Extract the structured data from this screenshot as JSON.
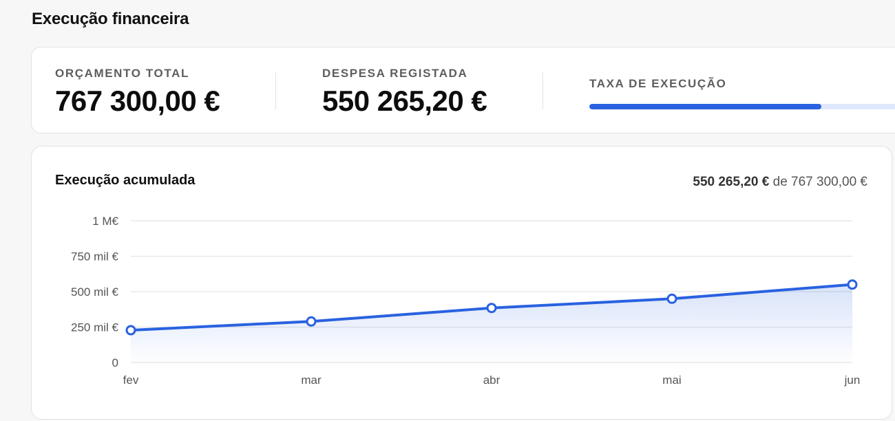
{
  "page": {
    "title": "Execução financeira"
  },
  "summary": {
    "budget": {
      "label": "ORÇAMENTO TOTAL",
      "value": "767 300,00 €"
    },
    "expense": {
      "label": "DESPESA REGISTADA",
      "value": "550 265,20 €"
    },
    "rate": {
      "label": "TAXA DE EXECUÇÃO",
      "progress_percent": 71.7
    }
  },
  "chart_header": {
    "title": "Execução acumulada",
    "spent": "550 265,20 €",
    "connector": "de",
    "total": "767 300,00 €"
  },
  "chart_data": {
    "type": "area",
    "title": "Execução acumulada",
    "categories": [
      "fev",
      "mar",
      "abr",
      "mai",
      "jun"
    ],
    "series": [
      {
        "values": [
          228000,
          290000,
          385000,
          450000,
          550265.2
        ]
      }
    ],
    "ylim": [
      0,
      1000000
    ],
    "yticks": [
      0,
      250000,
      500000,
      750000,
      1000000
    ],
    "ytick_labels": [
      "0",
      "250 mil €",
      "500 mil €",
      "750 mil €",
      "1 M€"
    ],
    "grid": true,
    "colors": {
      "line": "#2962e0",
      "fill": "#2962e0",
      "grid": "#e4e4e4"
    }
  }
}
